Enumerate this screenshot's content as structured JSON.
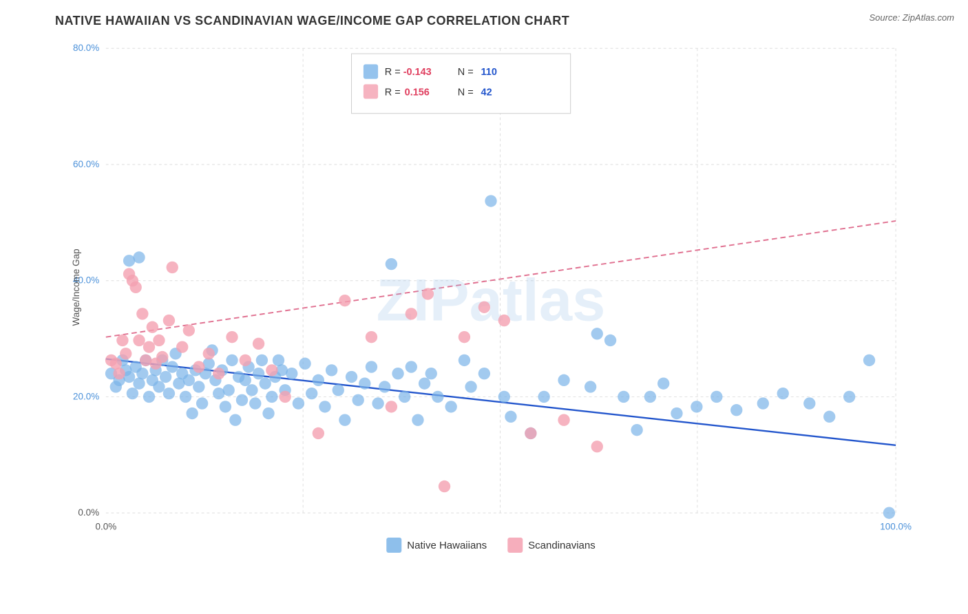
{
  "title": "NATIVE HAWAIIAN VS SCANDINAVIAN WAGE/INCOME GAP CORRELATION CHART",
  "source": "Source: ZipAtlas.com",
  "legend": {
    "series1": {
      "label": "Native Hawaiians",
      "color": "#7ab4e8",
      "r_value": "-0.143",
      "n_value": "110"
    },
    "series2": {
      "label": "Scandinavians",
      "color": "#f4a0b0",
      "r_value": "0.156",
      "n_value": "42"
    }
  },
  "axes": {
    "x_min": "0.0%",
    "x_max": "100.0%",
    "y_labels": [
      "20.0%",
      "40.0%",
      "60.0%",
      "80.0%"
    ],
    "y_axis_label": "Wage/Income Gap"
  },
  "watermark": "ZIPatlas"
}
